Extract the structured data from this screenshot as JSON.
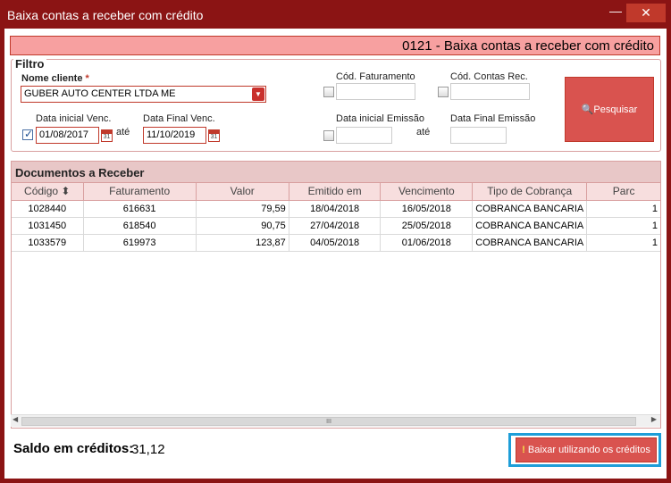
{
  "window": {
    "title": "Baixa contas a receber com crédito",
    "minimize": "—",
    "close": "✕"
  },
  "header": {
    "title": "0121 - Baixa contas a receber com crédito"
  },
  "filtro": {
    "legend": "Filtro",
    "nome_cliente_label": "Nome cliente",
    "required_mark": "*",
    "nome_cliente_value": "GUBER AUTO CENTER LTDA ME",
    "cod_faturamento_label": "Cód. Faturamento",
    "cod_faturamento_value": "",
    "cod_contas_rec_label": "Cód. Contas Rec.",
    "cod_contas_rec_value": "",
    "data_inicial_venc_label": "Data inicial Venc.",
    "data_inicial_venc_value": "01/08/2017",
    "ate_label": "até",
    "data_final_venc_label": "Data Final Venc.",
    "data_final_venc_value": "11/10/2019",
    "data_inicial_emissao_label": "Data inicial Emissão",
    "data_inicial_emissao_value": "",
    "data_final_emissao_label": "Data Final Emissão",
    "data_final_emissao_value": "",
    "calendar_num": "31",
    "pesquisar_label": "Pesquisar"
  },
  "grid": {
    "title": "Documentos a Receber",
    "columns": [
      "Código",
      "Faturamento",
      "Valor",
      "Emitido em",
      "Vencimento",
      "Tipo de Cobrança",
      "Parc"
    ],
    "sort_indicator": "⬍",
    "rows": [
      [
        "1028440",
        "616631",
        "79,59",
        "18/04/2018",
        "16/05/2018",
        "COBRANCA BANCARIA",
        "1"
      ],
      [
        "1031450",
        "618540",
        "90,75",
        "27/04/2018",
        "25/05/2018",
        "COBRANCA BANCARIA",
        "1"
      ],
      [
        "1033579",
        "619973",
        "123,87",
        "04/05/2018",
        "01/06/2018",
        "COBRANCA BANCARIA",
        "1"
      ]
    ],
    "scroll_grip": "III"
  },
  "footer": {
    "saldo_label": "Saldo em créditos:",
    "saldo_value": "31,12",
    "baixar_label": "Baixar utilizando os créditos",
    "baixar_icon": "!"
  }
}
